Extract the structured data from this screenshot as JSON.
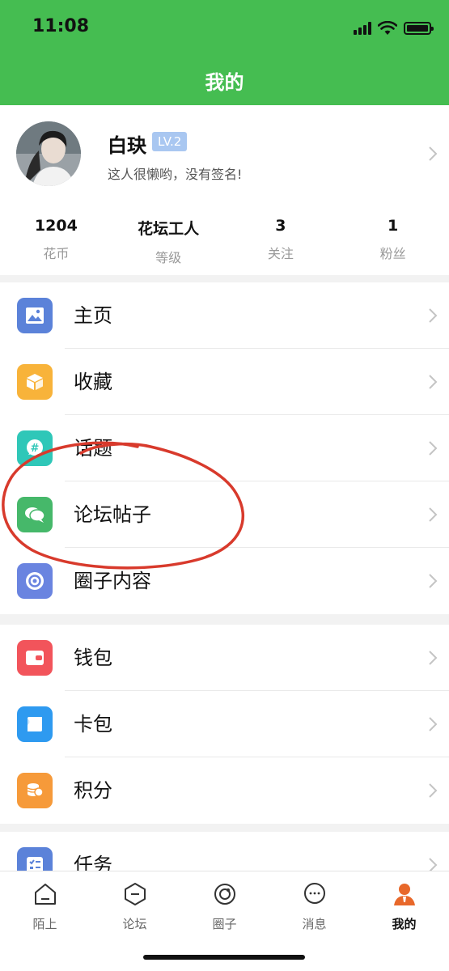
{
  "status": {
    "time": "11:08"
  },
  "header": {
    "title": "我的"
  },
  "profile": {
    "name": "白玦",
    "level": "LV.2",
    "signature": "这人很懒哟，没有签名!",
    "stats": [
      {
        "value": "1204",
        "label": "花币"
      },
      {
        "value": "花坛工人",
        "label": "等级"
      },
      {
        "value": "3",
        "label": "关注"
      },
      {
        "value": "1",
        "label": "粉丝"
      }
    ]
  },
  "menu": {
    "group1": [
      {
        "label": "主页",
        "icon": "image-icon",
        "color": "#5b82d9"
      },
      {
        "label": "收藏",
        "icon": "box-icon",
        "color": "#f8b33a"
      },
      {
        "label": "话题",
        "icon": "hashtag-bubble-icon",
        "color": "#2fc7b8"
      },
      {
        "label": "论坛帖子",
        "icon": "chat-bubbles-icon",
        "color": "#46b86a"
      },
      {
        "label": "圈子内容",
        "icon": "circle-swirl-icon",
        "color": "#6a84e0"
      }
    ],
    "group2": [
      {
        "label": "钱包",
        "icon": "wallet-icon",
        "color": "#f2545b"
      },
      {
        "label": "卡包",
        "icon": "card-icon",
        "color": "#2e9af0"
      },
      {
        "label": "积分",
        "icon": "coins-icon",
        "color": "#f69a3a"
      }
    ],
    "group3": [
      {
        "label": "任务",
        "icon": "task-list-icon",
        "color": "#5b82d9"
      }
    ]
  },
  "tabbar": {
    "tabs": [
      {
        "label": "陌上",
        "icon": "home-icon",
        "active": false
      },
      {
        "label": "论坛",
        "icon": "forum-hex-icon",
        "active": false
      },
      {
        "label": "圈子",
        "icon": "circle-icon",
        "active": false
      },
      {
        "label": "消息",
        "icon": "message-icon",
        "active": false
      },
      {
        "label": "我的",
        "icon": "person-icon",
        "active": true
      }
    ],
    "accent": "#e8682a"
  },
  "colors": {
    "brand_green": "#45bd51",
    "badge_blue": "#a9c7f1"
  }
}
